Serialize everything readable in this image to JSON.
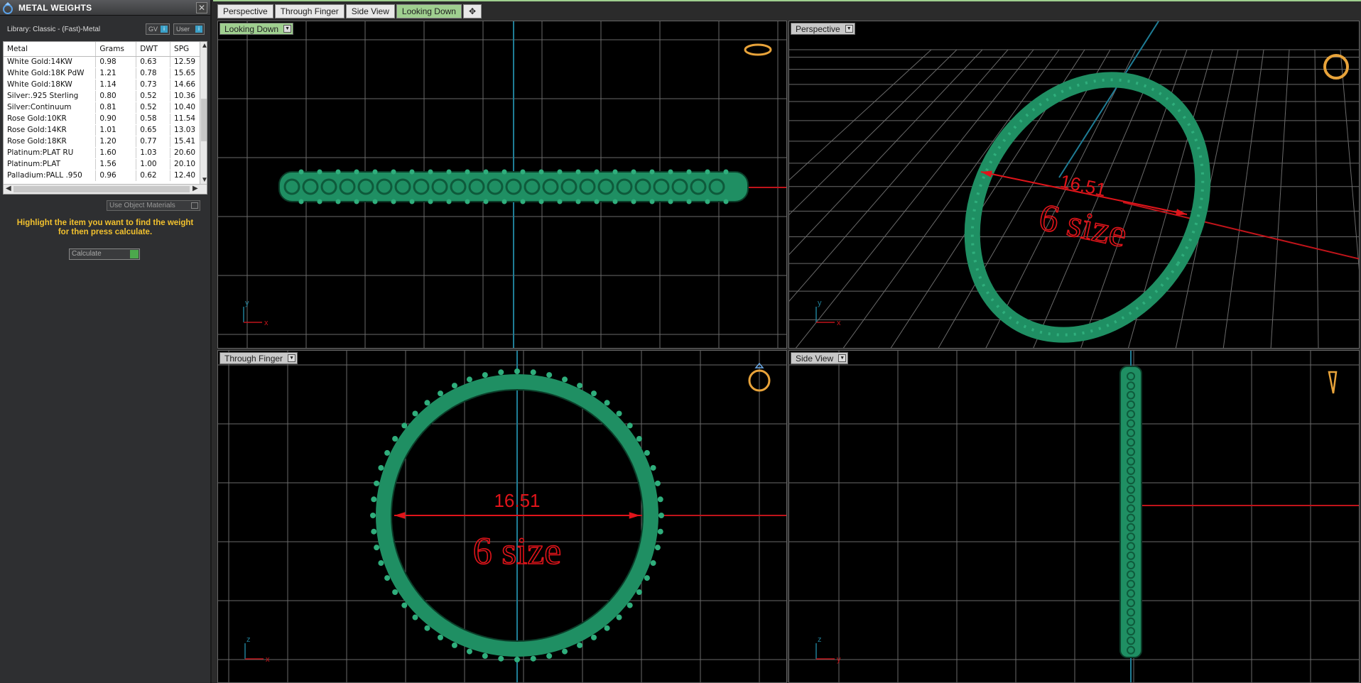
{
  "panel": {
    "title": "METAL WEIGHTS",
    "library_label": "Library: Classic - (Fast)-Metal",
    "gv_label": "GV",
    "user_label": "User",
    "columns": [
      "Metal",
      "Grams",
      "DWT",
      "SPG"
    ],
    "rows": [
      [
        "White Gold:14KW",
        "0.98",
        "0.63",
        "12.59"
      ],
      [
        "White Gold:18K PdW",
        "1.21",
        "0.78",
        "15.65"
      ],
      [
        "White Gold:18KW",
        "1.14",
        "0.73",
        "14.66"
      ],
      [
        "Silver:.925 Sterling",
        "0.80",
        "0.52",
        "10.36"
      ],
      [
        "Silver:Continuum",
        "0.81",
        "0.52",
        "10.40"
      ],
      [
        "Rose Gold:10KR",
        "0.90",
        "0.58",
        "11.54"
      ],
      [
        "Rose Gold:14KR",
        "1.01",
        "0.65",
        "13.03"
      ],
      [
        "Rose Gold:18KR",
        "1.20",
        "0.77",
        "15.41"
      ],
      [
        "Platinum:PLAT RU",
        "1.60",
        "1.03",
        "20.60"
      ],
      [
        "Platinum:PLAT",
        "1.56",
        "1.00",
        "20.10"
      ],
      [
        "Palladium:PALL .950",
        "0.96",
        "0.62",
        "12.40"
      ]
    ],
    "use_object_materials": "Use Object Materials",
    "hint_line1": "Highlight the item you want to find the weight",
    "hint_line2": "for then press calculate.",
    "calculate_label": "Calculate"
  },
  "tabs": [
    "Perspective",
    "Through Finger",
    "Side View",
    "Looking Down",
    "✥"
  ],
  "active_tab": "Looking Down",
  "viewports": {
    "top_left": {
      "label": "Looking Down",
      "axis_a": "y",
      "axis_b": "x"
    },
    "top_right": {
      "label": "Perspective",
      "dimension": "16.51",
      "size_text": "6 size",
      "axis_a": "y",
      "axis_b": "x"
    },
    "bottom_left": {
      "label": "Through Finger",
      "dimension": "16.51",
      "size_text": "6 size",
      "axis_a": "z",
      "axis_b": "x"
    },
    "bottom_right": {
      "label": "Side View",
      "axis_a": "z",
      "axis_b": "y"
    }
  },
  "colors": {
    "ring": "#1f8f63",
    "ring_light": "#2fae7c",
    "dimension": "#e0141a",
    "axis_x": "#c0141a",
    "axis_v": "#1f7d96",
    "grid": "#6a6a6a",
    "hint": "#f2c12e",
    "icon": "#e8a33a"
  }
}
